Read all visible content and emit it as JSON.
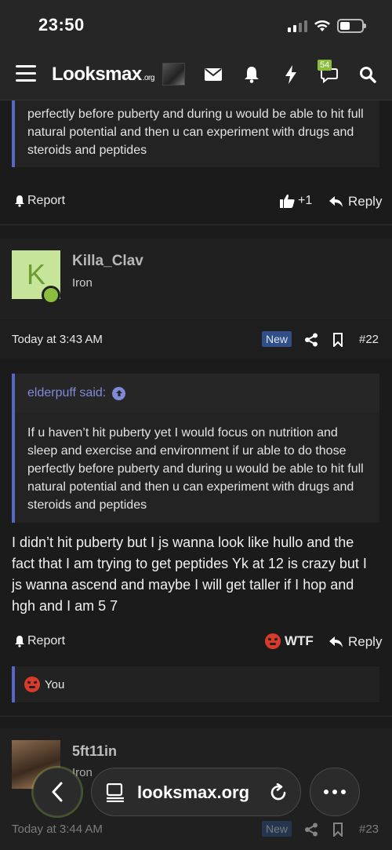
{
  "status": {
    "time": "23:50"
  },
  "navbar": {
    "logo": "Looksmax",
    "logo_suffix": ".org",
    "badge_count": "54"
  },
  "prev_post": {
    "quote_text": "perfectly before puberty and during u would be able to hit full natural potential and then u can experiment with drugs and steroids and peptides",
    "report_label": "Report",
    "like_count": "+1",
    "reply_label": "Reply"
  },
  "post": {
    "avatar_letter": "K",
    "username": "Killa_Clav",
    "user_title": "Iron",
    "timestamp": "Today at 3:43 AM",
    "new_badge": "New",
    "post_number": "#22",
    "quote_author": "elderpuff said:",
    "quote_text": "If u haven’t hit puberty yet I would focus on nutrition and sleep and exercise and environment if ur able to do those perfectly before puberty and during u would be able to hit full natural potential and then u can experiment with drugs and steroids and peptides",
    "body": "I didn’t hit puberty but I js wanna look like hullo and the fact that I am trying to get peptides Yk at 12 is crazy but I js wanna ascend and maybe I will get taller if I hop and hgh and I am 5 7",
    "report_label": "Report",
    "reaction_label": "WTF",
    "reply_label": "Reply",
    "reaction_by": "You"
  },
  "next_post": {
    "username": "5ft11in",
    "user_title": "Iron",
    "timestamp": "Today at 3:44 AM",
    "new_badge": "New",
    "post_number": "#23"
  },
  "browser": {
    "url": "looksmax.org"
  },
  "colors": {
    "accent": "#5767c7",
    "online": "#8bbd3f",
    "wtf": "#d93b2b",
    "badge_new": "#2f4f86"
  }
}
